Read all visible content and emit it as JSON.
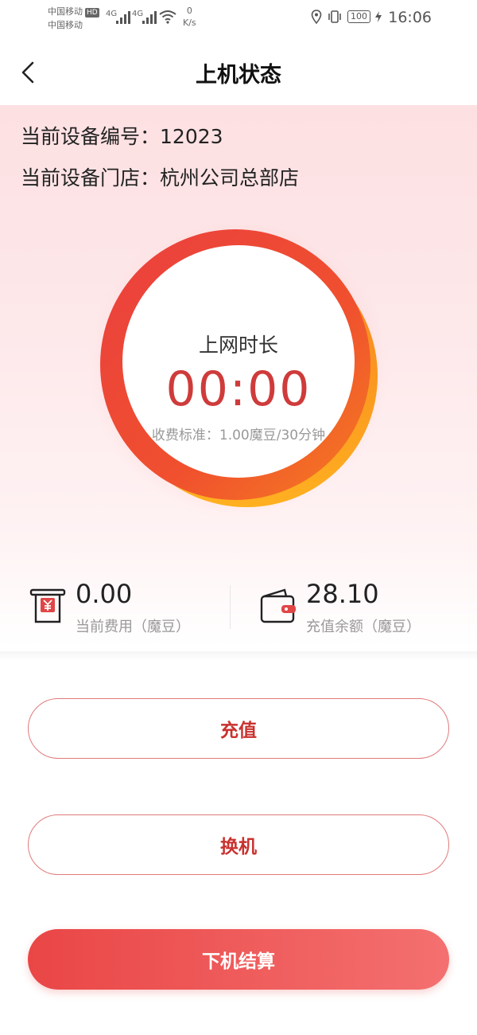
{
  "status_bar": {
    "carrier_1": "中国移动",
    "hd_badge": "HD",
    "carrier_2": "中国移动",
    "signal_1": "4G",
    "signal_2": "4G",
    "speed_value": "0",
    "speed_unit": "K/s",
    "battery": "100",
    "time": "16:06"
  },
  "nav": {
    "title": "上机状态"
  },
  "device": {
    "number_label": "当前设备编号：",
    "number": "12023",
    "store_label": "当前设备门店：",
    "store": "杭州公司总部店"
  },
  "timer": {
    "label": "上网时长",
    "time": "00:00",
    "rate": "收费标准：1.00魔豆/30分钟"
  },
  "stats": {
    "current_cost": {
      "value": "0.00",
      "label": "当前费用（魔豆）"
    },
    "balance": {
      "value": "28.10",
      "label": "充值余额（魔豆）"
    }
  },
  "actions": {
    "recharge": "充值",
    "switch_machine": "换机",
    "checkout": "下机结算"
  },
  "colors": {
    "accent": "#cf3b3b",
    "button_fill": "#ea4646",
    "ring_orange": "#f57f20",
    "ring_red": "#ea3f3f"
  },
  "icons": {
    "back": "chevron-left-icon",
    "cost": "receipt-yuan-icon",
    "balance": "wallet-icon"
  }
}
